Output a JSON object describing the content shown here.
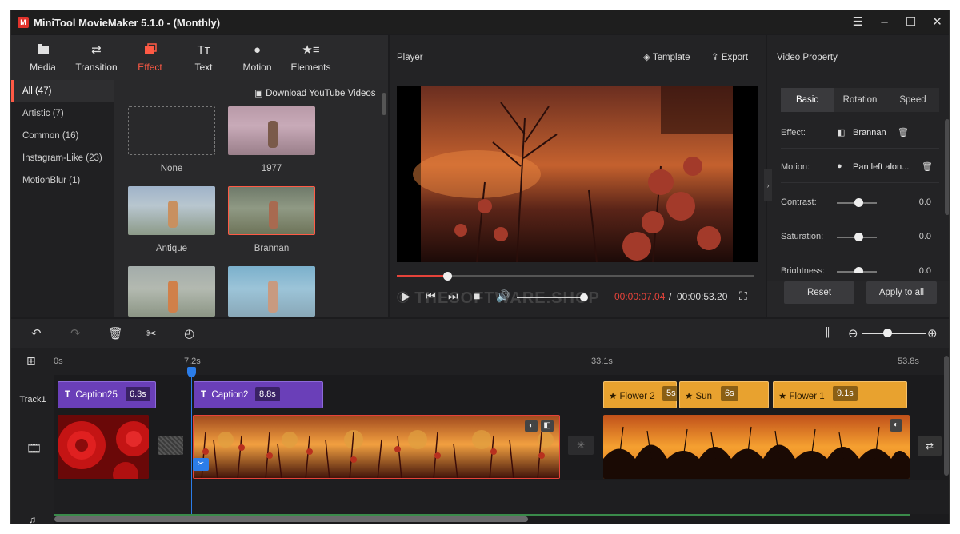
{
  "window": {
    "title": "MiniTool MovieMaker 5.1.0 - (Monthly)",
    "controls": [
      "☰",
      "–",
      "☐",
      "✕"
    ]
  },
  "toolbar": {
    "tabs": [
      {
        "label": "Media",
        "icon": "media-icon"
      },
      {
        "label": "Transition",
        "icon": "transition-icon"
      },
      {
        "label": "Effect",
        "icon": "effect-icon",
        "active": true
      },
      {
        "label": "Text",
        "icon": "text-icon"
      },
      {
        "label": "Motion",
        "icon": "motion-icon"
      },
      {
        "label": "Elements",
        "icon": "elements-icon"
      }
    ]
  },
  "categories": [
    {
      "label": "All (47)",
      "active": true
    },
    {
      "label": "Artistic (7)"
    },
    {
      "label": "Common (16)"
    },
    {
      "label": "Instagram-Like (23)"
    },
    {
      "label": "MotionBlur (1)"
    }
  ],
  "library": {
    "download_label": "Download YouTube Videos",
    "effects": [
      {
        "label": "None"
      },
      {
        "label": "1977"
      },
      {
        "label": "Antique"
      },
      {
        "label": "Brannan",
        "selected": true
      },
      {
        "label": ""
      },
      {
        "label": ""
      }
    ]
  },
  "player": {
    "title": "Player",
    "template_label": "Template",
    "export_label": "Export",
    "current_time": "00:00:07.04",
    "separator": " / ",
    "total_time": "00:00:53.20",
    "progress": 0.134,
    "volume": 0.9,
    "watermark": "© THESOFTWARE.SHOP"
  },
  "properties": {
    "title": "Video Property",
    "tabs": [
      {
        "label": "Basic",
        "active": true
      },
      {
        "label": "Rotation"
      },
      {
        "label": "Speed"
      }
    ],
    "effect": {
      "label": "Effect:",
      "value": "Brannan"
    },
    "motion": {
      "label": "Motion:",
      "value": "Pan left alon..."
    },
    "contrast": {
      "label": "Contrast:",
      "value": "0.0"
    },
    "saturation": {
      "label": "Saturation:",
      "value": "0.0"
    },
    "brightness": {
      "label": "Brightness:",
      "value": "0.0"
    },
    "reset_label": "Reset",
    "apply_all_label": "Apply to all"
  },
  "timeline": {
    "ruler": [
      "0s",
      "7.2s",
      "33.1s",
      "53.8s"
    ],
    "track_label": "Track1",
    "captions": [
      {
        "name": "Caption25",
        "duration": "6.3s"
      },
      {
        "name": "Caption2",
        "duration": "8.8s"
      }
    ],
    "elements": [
      {
        "name": "Flower 2",
        "duration": "5s"
      },
      {
        "name": "Sun",
        "duration": "6s"
      },
      {
        "name": "Flower 1",
        "duration": "9.1s"
      }
    ],
    "zoom": 0.6
  },
  "colors": {
    "accent": "#ff5a45",
    "caption_clip": "#6a3fb8",
    "element_clip": "#e8a22f",
    "playhead": "#2b7de9"
  }
}
